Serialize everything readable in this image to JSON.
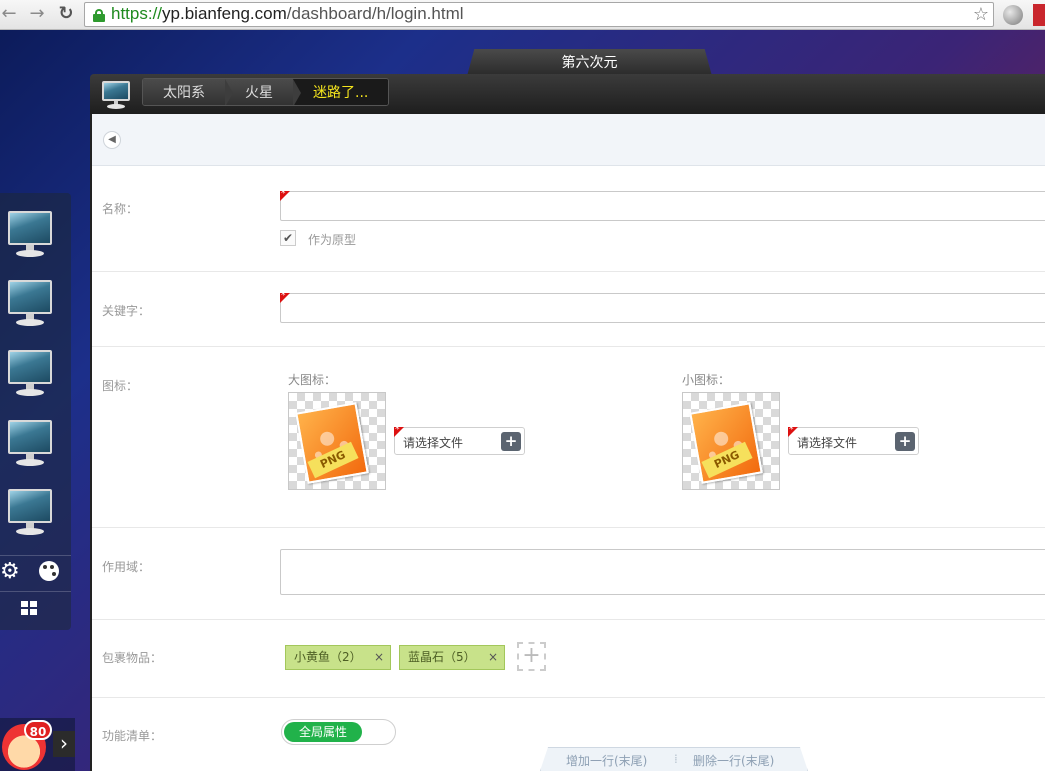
{
  "browser": {
    "url_scheme": "https://",
    "url_host": "yp.bianfeng.com",
    "url_path": "/dashboard/h/login.html"
  },
  "window": {
    "tab_title": "第六次元",
    "breadcrumb": [
      "太阳系",
      "火星",
      "迷路了..."
    ]
  },
  "form": {
    "name_label": "名称：",
    "prototype_checkbox_label": "作为原型",
    "prototype_checked": true,
    "keyword_label": "关键字：",
    "icon_label": "图标：",
    "large_icon_title": "大图标：",
    "small_icon_title": "小图标：",
    "png_tag": "PNG",
    "file_placeholder": "请选择文件",
    "scope_label": "作用域：",
    "package_label": "包裹物品：",
    "package_items": [
      {
        "text": "小黄鱼（2）"
      },
      {
        "text": "蓝晶石（5）"
      }
    ],
    "remove_symbol": "×",
    "functions_label": "功能清单：",
    "global_toggle_label": "全局属性",
    "add_row_label": "增加一行(末尾)",
    "delete_row_label": "删除一行(末尾)"
  },
  "dock": {
    "badge_count": "80"
  },
  "colors": {
    "required_marker": "#dd1111",
    "tag_green": "#c8e28a",
    "toggle_green": "#21b24a",
    "breadcrumb_active": "#f5e51d"
  }
}
